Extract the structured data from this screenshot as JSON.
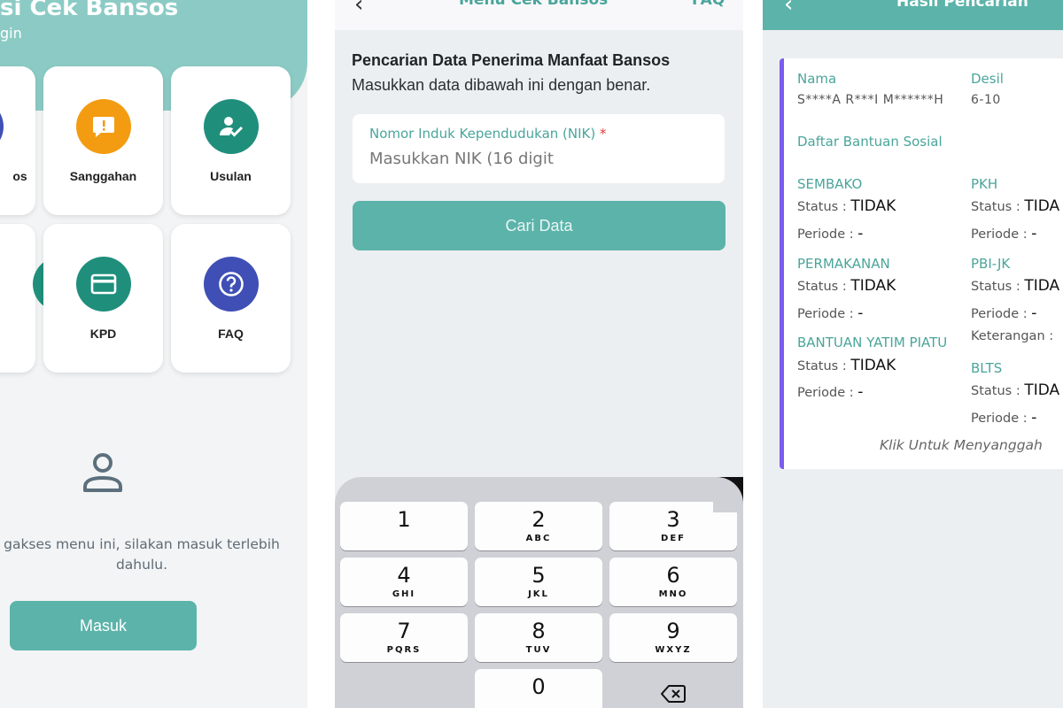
{
  "screen1": {
    "header_title": "si Cek Bansos",
    "header_subtitle": "gin",
    "menu": [
      {
        "label": "os",
        "icon": "bansos-icon",
        "color": "#3f51b5"
      },
      {
        "label": "Sanggahan",
        "icon": "alert-bubble-icon",
        "color": "#f39c12"
      },
      {
        "label": "Usulan",
        "icon": "user-check-icon",
        "color": "#1f8f7c"
      },
      {
        "label": "",
        "icon": "partial-icon",
        "color": "#1f8f7c"
      },
      {
        "label": "KPD",
        "icon": "card-icon",
        "color": "#1f8f7c"
      },
      {
        "label": "FAQ",
        "icon": "question-icon",
        "color": "#3f4fb5"
      }
    ],
    "login_message_line1": "gakses menu ini, silakan masuk terlebih",
    "login_message_line2": "dahulu.",
    "login_button": "Masuk"
  },
  "screen2": {
    "back_glyph": "‹",
    "title": "Menu Cek Bansos",
    "faq": "FAQ",
    "heading": "Pencarian Data Penerima Manfaat Bansos",
    "subheading": "Masukkan data dibawah ini dengan benar.",
    "nik_label": "Nomor Induk Kependudukan (NIK)",
    "nik_required": "*",
    "nik_placeholder": "Masukkan NIK (16 digit",
    "nik_value": "",
    "search_button": "Cari Data",
    "keypad": [
      {
        "digit": "1",
        "letters": ""
      },
      {
        "digit": "2",
        "letters": "ABC"
      },
      {
        "digit": "3",
        "letters": "DEF"
      },
      {
        "digit": "4",
        "letters": "GHI"
      },
      {
        "digit": "5",
        "letters": "JKL"
      },
      {
        "digit": "6",
        "letters": "MNO"
      },
      {
        "digit": "7",
        "letters": "PQRS"
      },
      {
        "digit": "8",
        "letters": "TUV"
      },
      {
        "digit": "9",
        "letters": "WXYZ"
      },
      {
        "digit": "0",
        "letters": ""
      }
    ]
  },
  "screen3": {
    "back_glyph": "‹",
    "title": "Hasil Pencarian",
    "nama_label": "Nama",
    "nama_value": "S****A R***I M******H",
    "desil_label": "Desil",
    "desil_value": "6-10",
    "daftar_label": "Daftar Bantuan Sosial",
    "programs_left": [
      {
        "name": "SEMBAKO",
        "status_label": "Status :",
        "status": "TIDAK",
        "periode_label": "Periode :",
        "periode": "-"
      },
      {
        "name": "PERMAKANAN",
        "status_label": "Status :",
        "status": "TIDAK",
        "periode_label": "Periode :",
        "periode": "-"
      },
      {
        "name": "BANTUAN YATIM PIATU",
        "status_label": "Status :",
        "status": "TIDAK",
        "periode_label": "Periode :",
        "periode": "-"
      }
    ],
    "programs_right": [
      {
        "name": "PKH",
        "status_label": "Status :",
        "status": "TIDA",
        "periode_label": "Periode :",
        "periode": "-"
      },
      {
        "name": "PBI-JK",
        "status_label": "Status :",
        "status": "TIDA",
        "periode_label": "Periode :",
        "periode": "-",
        "extra": "Keterangan :"
      },
      {
        "name": "BLTS",
        "status_label": "Status :",
        "status": "TIDA",
        "periode_label": "Periode :",
        "periode": "-"
      }
    ],
    "klik_text": "Klik Untuk Menyanggah"
  }
}
